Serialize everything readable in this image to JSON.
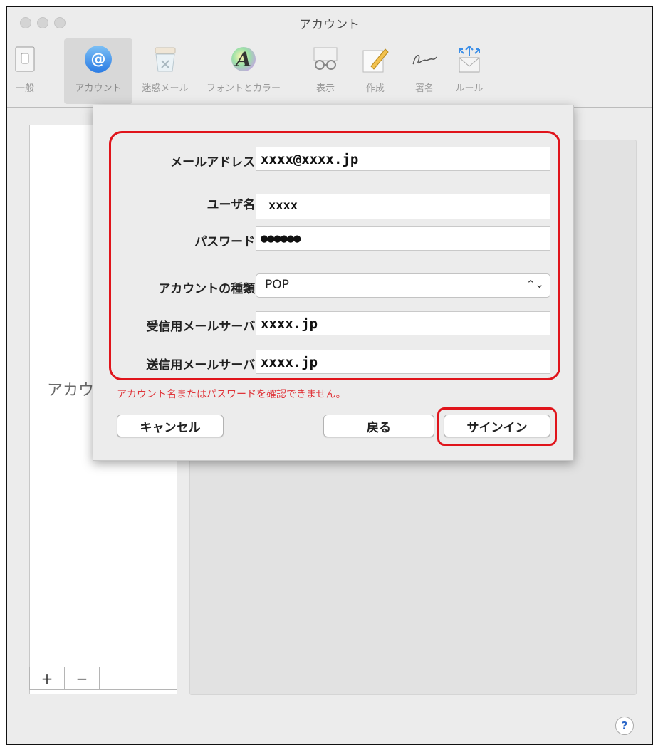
{
  "window": {
    "title": "アカウント"
  },
  "toolbar": {
    "items": [
      {
        "label": "一般",
        "icon": "switch-icon"
      },
      {
        "label": "アカウント",
        "icon": "at-sign-icon"
      },
      {
        "label": "迷惑メール",
        "icon": "junk-trash-icon"
      },
      {
        "label": "フォントとカラー",
        "icon": "font-color-icon"
      },
      {
        "label": "表示",
        "icon": "glasses-icon"
      },
      {
        "label": "作成",
        "icon": "pencil-icon"
      },
      {
        "label": "署名",
        "icon": "signature-icon"
      },
      {
        "label": "ルール",
        "icon": "rules-envelope-icon"
      }
    ]
  },
  "sidebar": {
    "ghost_text": "アカウ",
    "add_label": "+",
    "remove_label": "−"
  },
  "sheet": {
    "email_label": "メールアドレス:",
    "email_value": "xxxx@xxxx.jp",
    "username_label": "ユーザ名:",
    "username_value": "xxxx",
    "password_label": "パスワード:",
    "password_value": "●●●●●●",
    "account_type_label": "アカウントの種類:",
    "account_type_value": "POP",
    "incoming_label": "受信用メールサーバ:",
    "incoming_value": "xxxx.jp",
    "outgoing_label": "送信用メールサーバ:",
    "outgoing_value": "xxxx.jp",
    "error_text": "アカウント名またはパスワードを確認できません。",
    "cancel_label": "キャンセル",
    "back_label": "戻る",
    "signin_label": "サインイン"
  },
  "help": {
    "label": "?"
  },
  "colors": {
    "highlight": "#e0141b",
    "accent": "#2a7be4",
    "error": "#e0353a"
  }
}
